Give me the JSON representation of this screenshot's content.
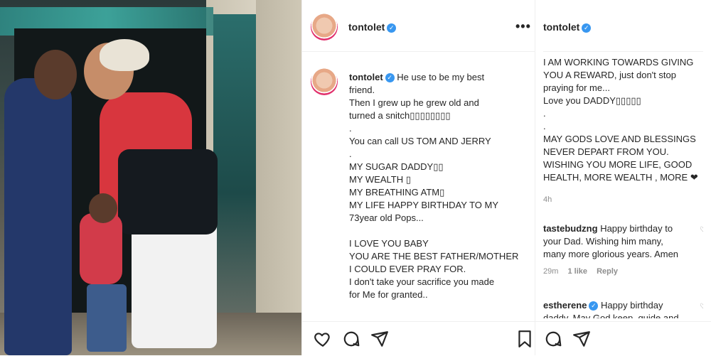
{
  "post": {
    "username": "tontolet",
    "more_label": "•••",
    "caption_lines": [
      "He use to be my best",
      "friend.",
      "Then I grew up he grew old and",
      "turned a snitch▯▯▯▯▯▯▯▯",
      ".",
      "You can call US TOM AND JERRY",
      ".",
      "MY SUGAR DADDY▯▯",
      "MY WEALTH ▯",
      "MY BREATHING ATM▯",
      "MY LIFE HAPPY BIRTHDAY TO MY",
      "73year old Pops...",
      "",
      "I LOVE YOU BABY",
      "YOU ARE THE BEST FATHER/MOTHER",
      "I COULD EVER PRAY FOR.",
      "I don't take your sacrifice you made",
      "for Me for granted.."
    ]
  },
  "right_panel": {
    "username": "tontolet",
    "caption_continued": [
      "I AM WORKING TOWARDS GIVING",
      "YOU A REWARD, just don't stop",
      "praying for me...",
      "Love you DADDY▯▯▯▯▯",
      ".",
      ".",
      "MAY GODS LOVE AND BLESSINGS",
      "NEVER DEPART FROM YOU.",
      "WISHING YOU MORE LIFE, GOOD",
      "HEALTH, MORE WEALTH , MORE ❤"
    ],
    "time_ago": "4h",
    "comments": [
      {
        "username": "tastebudzng",
        "text_first": "Happy birthday to",
        "text_rest": [
          "your Dad. Wishing him many,",
          "many more glorious years. Amen"
        ],
        "time": "29m",
        "likes": "1 like",
        "reply": "Reply"
      },
      {
        "username": "estherene",
        "text_first": "Happy birthday",
        "text_rest": [
          "daddy. May God keep, guide and"
        ]
      }
    ]
  },
  "icons": {
    "like": "heart-icon",
    "comment": "comment-icon",
    "share": "share-icon",
    "save": "bookmark-icon",
    "verified": "verified-badge-icon"
  },
  "colors": {
    "verified": "#3897f0",
    "accent_ring": "#e1306c"
  }
}
